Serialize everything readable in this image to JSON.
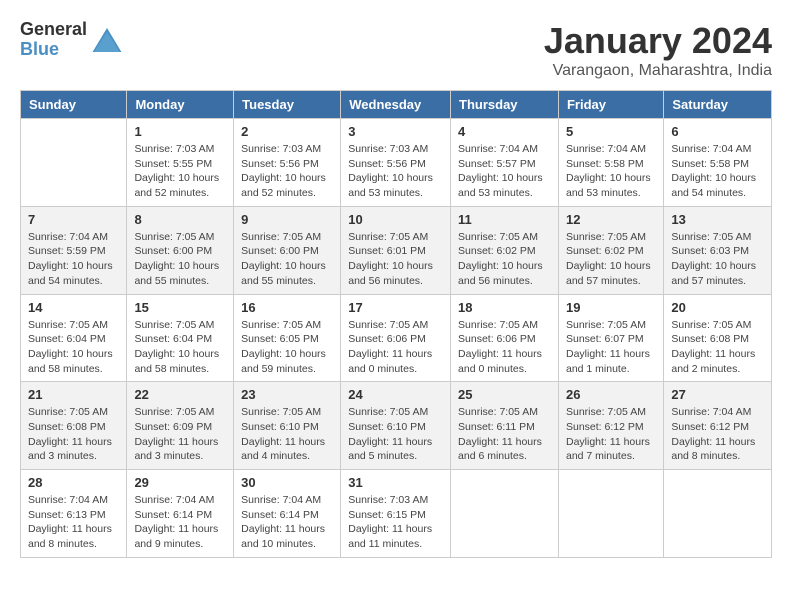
{
  "logo": {
    "general": "General",
    "blue": "Blue"
  },
  "title": "January 2024",
  "subtitle": "Varangaon, Maharashtra, India",
  "days_of_week": [
    "Sunday",
    "Monday",
    "Tuesday",
    "Wednesday",
    "Thursday",
    "Friday",
    "Saturday"
  ],
  "weeks": [
    [
      {
        "day": "",
        "sunrise": "",
        "sunset": "",
        "daylight": ""
      },
      {
        "day": "1",
        "sunrise": "7:03 AM",
        "sunset": "5:55 PM",
        "daylight": "10 hours and 52 minutes."
      },
      {
        "day": "2",
        "sunrise": "7:03 AM",
        "sunset": "5:56 PM",
        "daylight": "10 hours and 52 minutes."
      },
      {
        "day": "3",
        "sunrise": "7:03 AM",
        "sunset": "5:56 PM",
        "daylight": "10 hours and 53 minutes."
      },
      {
        "day": "4",
        "sunrise": "7:04 AM",
        "sunset": "5:57 PM",
        "daylight": "10 hours and 53 minutes."
      },
      {
        "day": "5",
        "sunrise": "7:04 AM",
        "sunset": "5:58 PM",
        "daylight": "10 hours and 53 minutes."
      },
      {
        "day": "6",
        "sunrise": "7:04 AM",
        "sunset": "5:58 PM",
        "daylight": "10 hours and 54 minutes."
      }
    ],
    [
      {
        "day": "7",
        "sunrise": "7:04 AM",
        "sunset": "5:59 PM",
        "daylight": "10 hours and 54 minutes."
      },
      {
        "day": "8",
        "sunrise": "7:05 AM",
        "sunset": "6:00 PM",
        "daylight": "10 hours and 55 minutes."
      },
      {
        "day": "9",
        "sunrise": "7:05 AM",
        "sunset": "6:00 PM",
        "daylight": "10 hours and 55 minutes."
      },
      {
        "day": "10",
        "sunrise": "7:05 AM",
        "sunset": "6:01 PM",
        "daylight": "10 hours and 56 minutes."
      },
      {
        "day": "11",
        "sunrise": "7:05 AM",
        "sunset": "6:02 PM",
        "daylight": "10 hours and 56 minutes."
      },
      {
        "day": "12",
        "sunrise": "7:05 AM",
        "sunset": "6:02 PM",
        "daylight": "10 hours and 57 minutes."
      },
      {
        "day": "13",
        "sunrise": "7:05 AM",
        "sunset": "6:03 PM",
        "daylight": "10 hours and 57 minutes."
      }
    ],
    [
      {
        "day": "14",
        "sunrise": "7:05 AM",
        "sunset": "6:04 PM",
        "daylight": "10 hours and 58 minutes."
      },
      {
        "day": "15",
        "sunrise": "7:05 AM",
        "sunset": "6:04 PM",
        "daylight": "10 hours and 58 minutes."
      },
      {
        "day": "16",
        "sunrise": "7:05 AM",
        "sunset": "6:05 PM",
        "daylight": "10 hours and 59 minutes."
      },
      {
        "day": "17",
        "sunrise": "7:05 AM",
        "sunset": "6:06 PM",
        "daylight": "11 hours and 0 minutes."
      },
      {
        "day": "18",
        "sunrise": "7:05 AM",
        "sunset": "6:06 PM",
        "daylight": "11 hours and 0 minutes."
      },
      {
        "day": "19",
        "sunrise": "7:05 AM",
        "sunset": "6:07 PM",
        "daylight": "11 hours and 1 minute."
      },
      {
        "day": "20",
        "sunrise": "7:05 AM",
        "sunset": "6:08 PM",
        "daylight": "11 hours and 2 minutes."
      }
    ],
    [
      {
        "day": "21",
        "sunrise": "7:05 AM",
        "sunset": "6:08 PM",
        "daylight": "11 hours and 3 minutes."
      },
      {
        "day": "22",
        "sunrise": "7:05 AM",
        "sunset": "6:09 PM",
        "daylight": "11 hours and 3 minutes."
      },
      {
        "day": "23",
        "sunrise": "7:05 AM",
        "sunset": "6:10 PM",
        "daylight": "11 hours and 4 minutes."
      },
      {
        "day": "24",
        "sunrise": "7:05 AM",
        "sunset": "6:10 PM",
        "daylight": "11 hours and 5 minutes."
      },
      {
        "day": "25",
        "sunrise": "7:05 AM",
        "sunset": "6:11 PM",
        "daylight": "11 hours and 6 minutes."
      },
      {
        "day": "26",
        "sunrise": "7:05 AM",
        "sunset": "6:12 PM",
        "daylight": "11 hours and 7 minutes."
      },
      {
        "day": "27",
        "sunrise": "7:04 AM",
        "sunset": "6:12 PM",
        "daylight": "11 hours and 8 minutes."
      }
    ],
    [
      {
        "day": "28",
        "sunrise": "7:04 AM",
        "sunset": "6:13 PM",
        "daylight": "11 hours and 8 minutes."
      },
      {
        "day": "29",
        "sunrise": "7:04 AM",
        "sunset": "6:14 PM",
        "daylight": "11 hours and 9 minutes."
      },
      {
        "day": "30",
        "sunrise": "7:04 AM",
        "sunset": "6:14 PM",
        "daylight": "11 hours and 10 minutes."
      },
      {
        "day": "31",
        "sunrise": "7:03 AM",
        "sunset": "6:15 PM",
        "daylight": "11 hours and 11 minutes."
      },
      {
        "day": "",
        "sunrise": "",
        "sunset": "",
        "daylight": ""
      },
      {
        "day": "",
        "sunrise": "",
        "sunset": "",
        "daylight": ""
      },
      {
        "day": "",
        "sunrise": "",
        "sunset": "",
        "daylight": ""
      }
    ]
  ],
  "labels": {
    "sunrise_prefix": "Sunrise: ",
    "sunset_prefix": "Sunset: ",
    "daylight_prefix": "Daylight: "
  }
}
